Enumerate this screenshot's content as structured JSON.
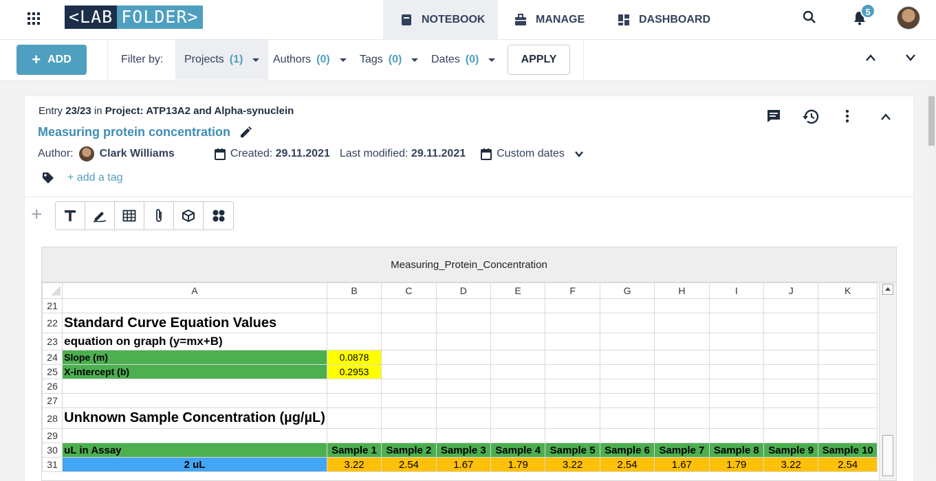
{
  "topbar": {
    "logo_left": "<LAB",
    "logo_right": "FOLDER>",
    "tabs": [
      {
        "label": "NOTEBOOK",
        "icon": "notebook-icon",
        "active": true
      },
      {
        "label": "MANAGE",
        "icon": "briefcase-icon",
        "active": false
      },
      {
        "label": "DASHBOARD",
        "icon": "dashboard-icon",
        "active": false
      }
    ],
    "notifications_count": "5"
  },
  "filterbar": {
    "add_label": "ADD",
    "filter_by_label": "Filter by:",
    "filters": [
      {
        "label": "Projects",
        "count": "(1)"
      },
      {
        "label": "Authors",
        "count": "(0)"
      },
      {
        "label": "Tags",
        "count": "(0)"
      },
      {
        "label": "Dates",
        "count": "(0)"
      }
    ],
    "apply_label": "APPLY"
  },
  "entry": {
    "entry_prefix": "Entry",
    "entry_number": "23/23",
    "in_label": "in",
    "project": "Project: ATP13A2 and Alpha-synuclein",
    "title": "Measuring protein concentration",
    "author_label": "Author:",
    "author_name": "Clark Williams",
    "created_label": "Created:",
    "created_date": "29.11.2021",
    "modified_label": "Last modified:",
    "modified_date": "29.11.2021",
    "custom_dates_label": "Custom dates",
    "add_tag_label": "+ add a tag"
  },
  "sheet": {
    "title": "Measuring_Protein_Concentration",
    "columns": [
      "A",
      "B",
      "C",
      "D",
      "E",
      "F",
      "G",
      "H",
      "I",
      "J",
      "K"
    ],
    "rows": {
      "r21": "21",
      "r22": "22",
      "r22_text": "Standard Curve Equation Values",
      "r23": "23",
      "r23_text": "equation on graph (y=mx+B)",
      "r24": "24",
      "r24_label": "Slope (m)",
      "r24_value": "0.0878",
      "r25": "25",
      "r25_label": "X-intercept (b)",
      "r25_value": "0.2953",
      "r26": "26",
      "r27": "27",
      "r28": "28",
      "r28_text": "Unknown Sample Concentration (µg/µL)",
      "r29": "29",
      "r30": "30",
      "r30_cells": [
        "uL in Assay",
        "Sample 1",
        "Sample 2",
        "Sample 3",
        "Sample 4",
        "Sample 5",
        "Sample 6",
        "Sample 7",
        "Sample 8",
        "Sample 9",
        "Sample 10"
      ],
      "r31": "31",
      "r31_cells": [
        "2 uL",
        "3.22",
        "2.54",
        "1.67",
        "1.79",
        "3.22",
        "2.54",
        "1.67",
        "1.79",
        "3.22",
        "2.54"
      ]
    }
  }
}
